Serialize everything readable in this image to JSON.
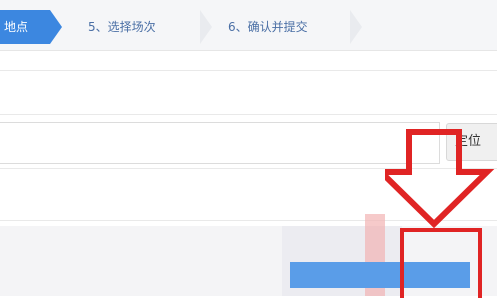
{
  "steps": [
    {
      "label": "地点"
    },
    {
      "label": "5、选择场次"
    },
    {
      "label": "6、确认并提交"
    }
  ],
  "form": {
    "locate_button_label": "定位"
  },
  "colors": {
    "active_step": "#3c87e0",
    "inactive_step_text": "#4a6fa5",
    "highlight_red": "#e02424"
  },
  "icons": [
    "down-arrow-icon"
  ]
}
